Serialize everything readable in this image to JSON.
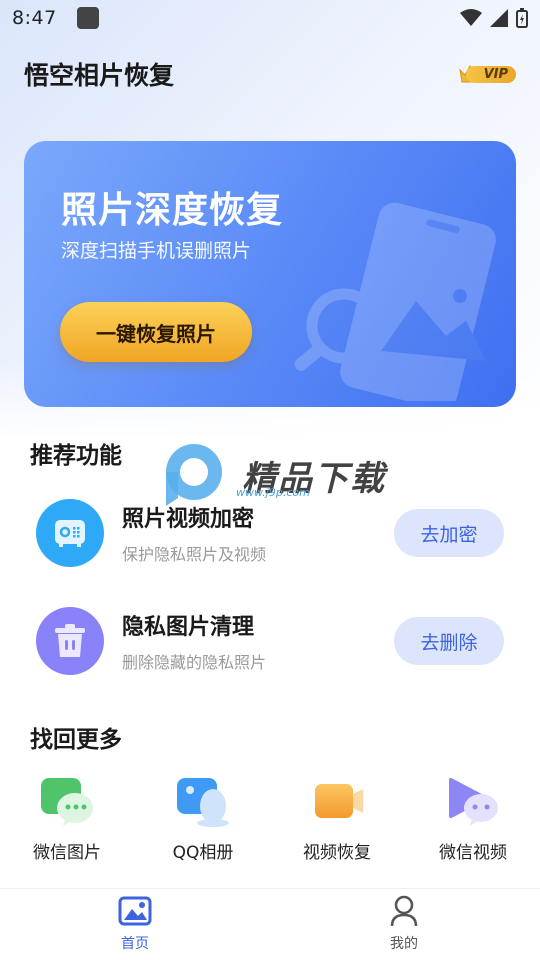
{
  "status_bar": {
    "time": "8:47"
  },
  "header": {
    "title": "悟空相片恢复",
    "vip_label": "VIP"
  },
  "banner": {
    "title": "照片深度恢复",
    "subtitle": "深度扫描手机误删照片",
    "button_label": "一键恢复照片"
  },
  "recommend": {
    "title": "推荐功能",
    "items": [
      {
        "name": "照片视频加密",
        "desc": "保护隐私照片及视频",
        "button": "去加密",
        "icon": "safe-box-icon"
      },
      {
        "name": "隐私图片清理",
        "desc": "删除隐藏的隐私照片",
        "button": "去删除",
        "icon": "trash-icon"
      }
    ]
  },
  "more": {
    "title": "找回更多",
    "items": [
      {
        "label": "微信图片",
        "icon": "wechat-image-icon"
      },
      {
        "label": "QQ相册",
        "icon": "qq-album-icon"
      },
      {
        "label": "视频恢复",
        "icon": "video-recover-icon"
      },
      {
        "label": "微信视频",
        "icon": "wechat-video-icon"
      }
    ]
  },
  "tabs": [
    {
      "label": "首页",
      "icon": "home-image-icon",
      "active": true
    },
    {
      "label": "我的",
      "icon": "person-icon",
      "active": false
    }
  ],
  "watermark": {
    "brand": "精品下载",
    "url": "www.j9p.com"
  },
  "colors": {
    "accent": "#3c63e0",
    "banner": "#5b8bf7",
    "cta": "#f0a623"
  }
}
